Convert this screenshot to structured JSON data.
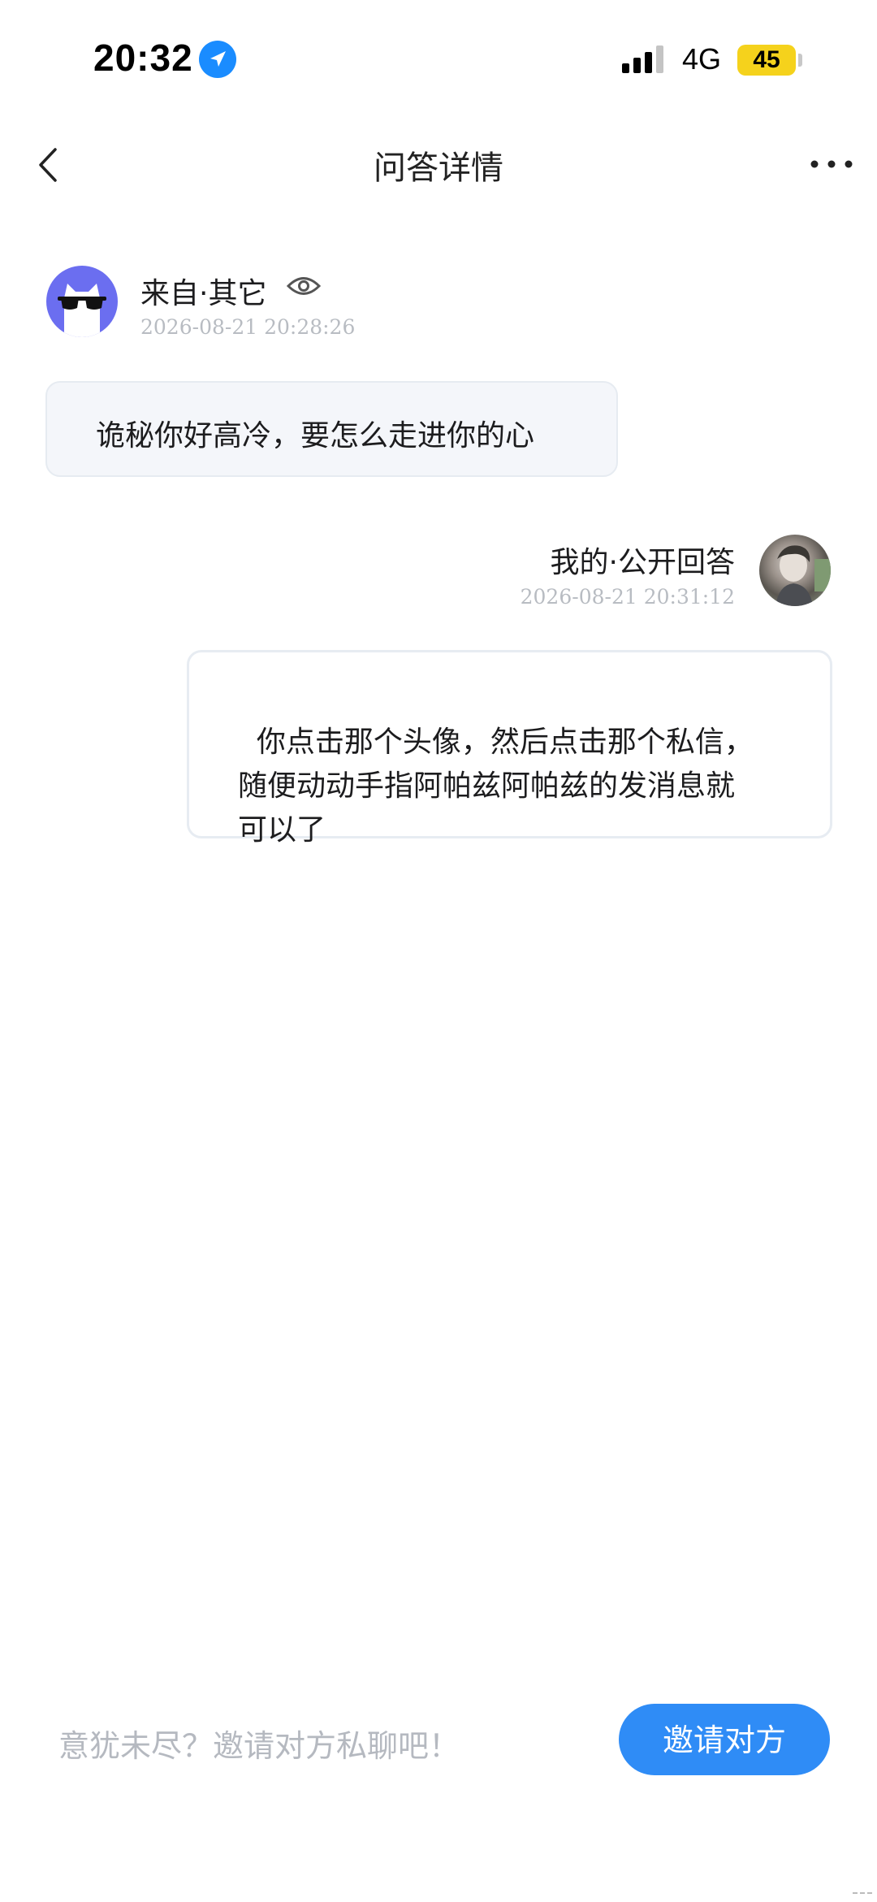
{
  "status_bar": {
    "time": "20:32",
    "network": "4G",
    "battery": "45",
    "location_icon": "location-arrow-icon",
    "signal_icon": "signal-bars-icon"
  },
  "nav": {
    "title": "问答详情",
    "back_icon": "chevron-left-icon",
    "more_icon": "more-dots-icon"
  },
  "question": {
    "source": "来自·其它",
    "time": "2026-08-21 20:28:26",
    "text": "诡秘你好高冷，要怎么走进你的心",
    "avatar_icon": "cat-sunglasses-avatar",
    "visibility_icon": "eye-icon"
  },
  "answer": {
    "label": "我的·公开回答",
    "time": "2026-08-21 20:31:12",
    "text": "你点击那个头像，然后点击那个私信，\n随便动动手指阿帕兹阿帕兹的发消息就\n可以了"
  },
  "bottom": {
    "hint": "意犹未尽？邀请对方私聊吧！",
    "invite_label": "邀请对方"
  },
  "colors": {
    "accent": "#2f8cf6",
    "question_bubble_bg": "#f4f6fa",
    "avatar_bg": "#6b6ef0",
    "battery": "#f5d21c"
  }
}
